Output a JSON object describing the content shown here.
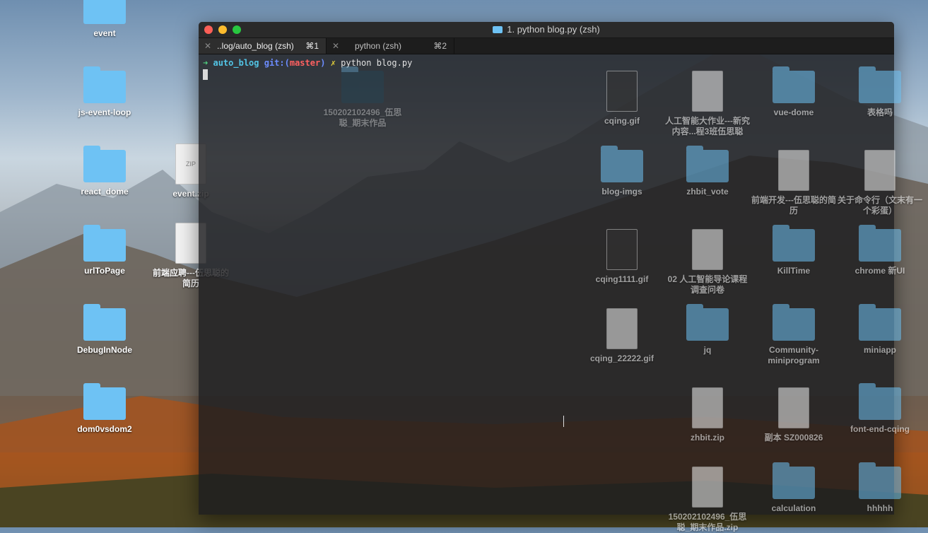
{
  "desktop": {
    "left_icons": [
      {
        "label": "event",
        "type": "folder"
      },
      {
        "label": "js-event-loop",
        "type": "folder"
      },
      {
        "label": "react_dome",
        "type": "folder"
      },
      {
        "label": "urlToPage",
        "type": "folder"
      },
      {
        "label": "DebugInNode",
        "type": "folder"
      },
      {
        "label": "dom0vsdom2",
        "type": "folder"
      }
    ],
    "zip_icon": {
      "label": "event.zip",
      "badge": "ZIP"
    },
    "doc_icon": {
      "label": "前端应聘---伍思聪的简历"
    },
    "right_icons": [
      {
        "label": "cqing.gif"
      },
      {
        "label": "人工智能大作业---新究内容...程3班伍思聪"
      },
      {
        "label": "vue-dome"
      },
      {
        "label": "表格吗"
      },
      {
        "label": "blog-imgs"
      },
      {
        "label": "zhbit_vote"
      },
      {
        "label": "前端开发---伍思聪的简历"
      },
      {
        "label": "关于命令行（文末有一个彩蛋）"
      },
      {
        "label": "cqing1111.gif"
      },
      {
        "label": "02 人工智能导论课程调查问卷"
      },
      {
        "label": "KillTime"
      },
      {
        "label": "chrome 新UI"
      },
      {
        "label": "cqing_22222.gif"
      },
      {
        "label": "jq"
      },
      {
        "label": "Community-miniprogram"
      },
      {
        "label": "miniapp"
      },
      {
        "label": "zhbit.zip"
      },
      {
        "label": "副本 SZ000826"
      },
      {
        "label": "font-end-cqing"
      },
      {
        "label": "150202102496_伍思聪_期末作品.zip"
      },
      {
        "label": "calculation"
      },
      {
        "label": "hhhhh"
      }
    ],
    "overlay_label": "150202102496_伍思聪_期末作品"
  },
  "terminal": {
    "window_title": "1. python blog.py (zsh)",
    "tabs": [
      {
        "label": "..log/auto_blog (zsh)",
        "shortcut": "⌘1",
        "active": true
      },
      {
        "label": "python (zsh)",
        "shortcut": "⌘2",
        "active": false
      }
    ],
    "prompt": {
      "arrow": "➜",
      "directory": "auto_blog",
      "git_prefix": "git:(",
      "branch": "master",
      "git_suffix": ")",
      "dirty_mark": "✗",
      "command": "python blog.py"
    },
    "colors": {
      "close": "#fc5f57",
      "minimize": "#fdbc2e",
      "maximize": "#28c840"
    }
  }
}
